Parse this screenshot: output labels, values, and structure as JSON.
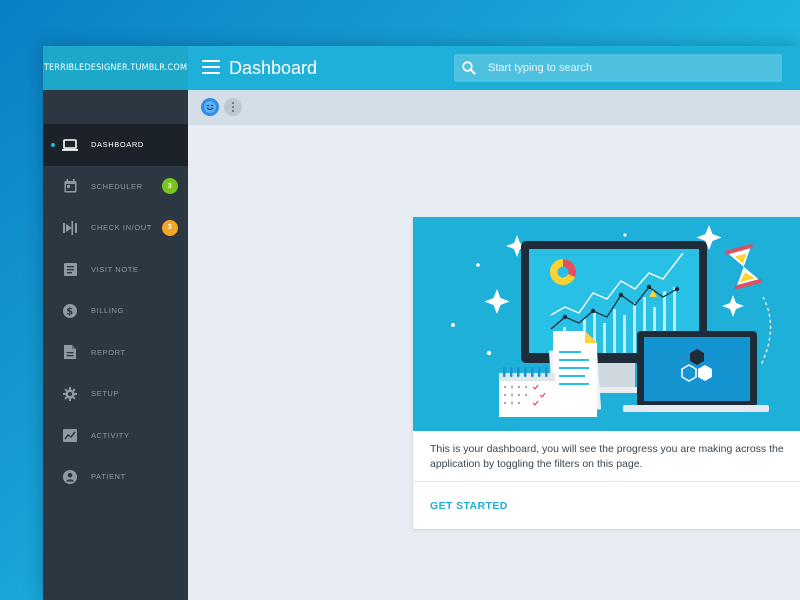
{
  "brand": {
    "label": "TERRIBLEDESIGNER.TUMBLR.COM"
  },
  "header": {
    "title": "Dashboard",
    "search": {
      "placeholder": "Start typing to search"
    }
  },
  "sidebar": {
    "items": [
      {
        "label": "DASHBOARD",
        "icon": "laptop-icon",
        "active": true
      },
      {
        "label": "SCHEDULER",
        "icon": "calendar-icon",
        "badge": "3",
        "badge_color": "#7ac41f"
      },
      {
        "label": "CHECK IN/OUT",
        "icon": "check-in-out-icon",
        "badge": "3",
        "badge_color": "#f5a623"
      },
      {
        "label": "VISIT NOTE",
        "icon": "note-icon"
      },
      {
        "label": "BILLING",
        "icon": "dollar-icon"
      },
      {
        "label": "REPORT",
        "icon": "report-icon"
      },
      {
        "label": "SETUP",
        "icon": "gear-icon"
      },
      {
        "label": "ACTIVITY",
        "icon": "activity-icon"
      },
      {
        "label": "PATIENT",
        "icon": "patient-icon"
      }
    ]
  },
  "card": {
    "description": "This is your        dashboard, you will see the progress you are making across the application by toggling the filters on this page.",
    "action_label": "GET STARTED"
  },
  "colors": {
    "accent": "#1eb0d8",
    "sidebar": "#2c3742",
    "sidebar_active": "#1b2229"
  }
}
